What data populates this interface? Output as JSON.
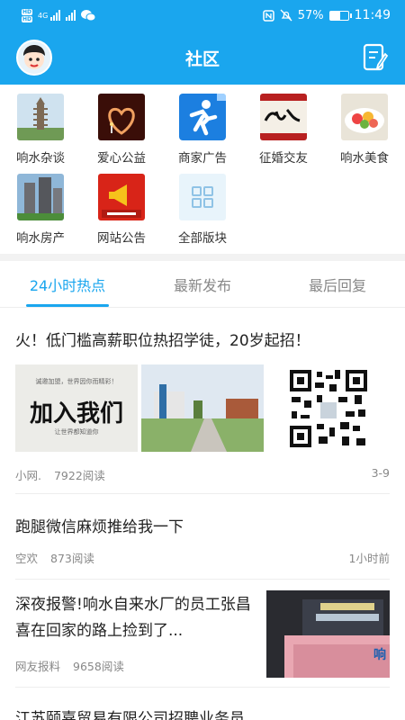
{
  "status": {
    "time": "11:49",
    "battery": "57%",
    "battery_level": 0.57,
    "net1": "4G",
    "hd": "HD"
  },
  "header": {
    "title": "社区"
  },
  "boards": [
    {
      "label": "响水杂谈",
      "icon": "pagoda-photo"
    },
    {
      "label": "爱心公益",
      "icon": "heart-candle-photo"
    },
    {
      "label": "商家广告",
      "icon": "runner-logo"
    },
    {
      "label": "征婚交友",
      "icon": "calligraphy-photo"
    },
    {
      "label": "响水美食",
      "icon": "food-photo"
    },
    {
      "label": "响水房产",
      "icon": "building-photo"
    },
    {
      "label": "网站公告",
      "icon": "megaphone-logo"
    },
    {
      "label": "全部版块",
      "icon": "grid-icon"
    }
  ],
  "tabs": [
    {
      "label": "24小时热点",
      "active": true
    },
    {
      "label": "最新发布",
      "active": false
    },
    {
      "label": "最后回复",
      "active": false
    }
  ],
  "posts": [
    {
      "title": "火！低门槛高薪职位热招学徒，20岁起招！",
      "author": "小网.",
      "views": "7922阅读",
      "time": "3-9",
      "image_texts": [
        "加入我们",
        "让世界都知道你",
        "诚邀加盟，世界因你而精彩！"
      ]
    },
    {
      "title": "跑腿微信麻烦推给我一下",
      "author": "空欢",
      "views": "873阅读",
      "time": "1小时前"
    },
    {
      "title": "深夜报警!响水自来水厂的员工张昌喜在回家的路上捡到了...",
      "author": "网友报料",
      "views": "9658阅读",
      "time": "",
      "image_text": "响"
    },
    {
      "title": "江苏颐嘉贸易有限公司招聘业务员"
    }
  ],
  "colors": {
    "accent": "#1aa6ee"
  }
}
